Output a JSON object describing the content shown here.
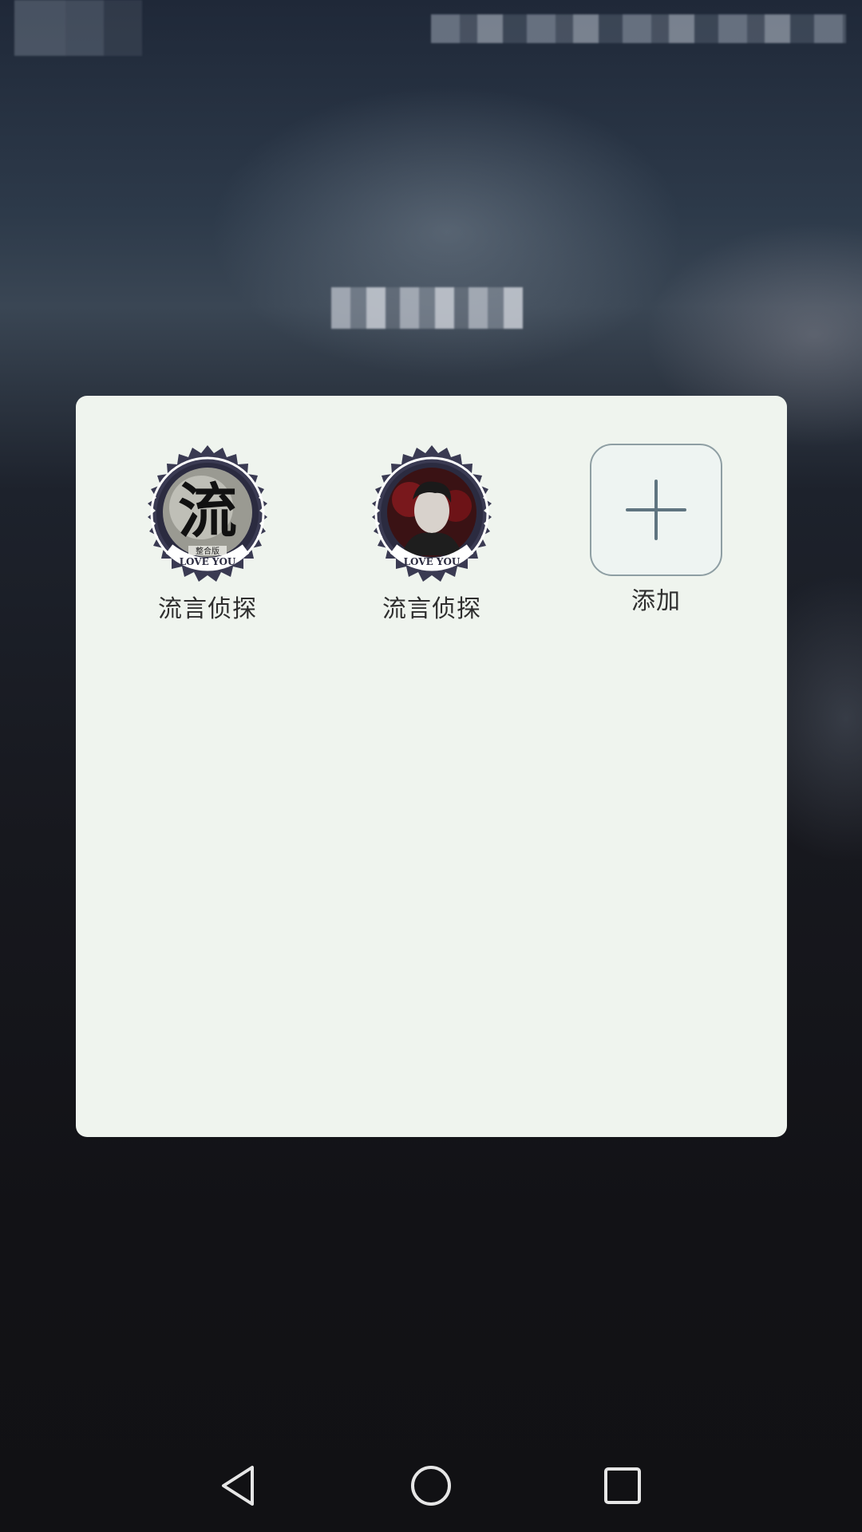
{
  "folder": {
    "apps": [
      {
        "label": "流言侦探",
        "icon": "liuyan-seal-icon",
        "seal_text": "流",
        "seal_sub": "整合版",
        "ring_text": "LOVE YOU"
      },
      {
        "label": "流言侦探",
        "icon": "liuyan-portrait-seal-icon",
        "ring_text": "LOVE YOU"
      }
    ],
    "add": {
      "label": "添加",
      "icon": "plus-icon"
    }
  },
  "nav": {
    "back_icon": "back-triangle-icon",
    "home_icon": "home-circle-icon",
    "recent_icon": "recent-square-icon"
  },
  "colors": {
    "panel_bg": "#eff4ee",
    "plus_stroke": "#5f7480",
    "seal_dark": "#3a3a52",
    "label_text": "#2e2e2e"
  }
}
